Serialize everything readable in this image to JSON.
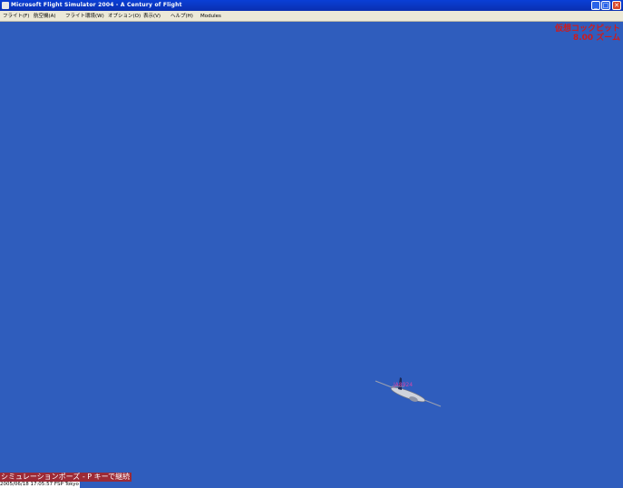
{
  "window": {
    "title": "Microsoft Flight Simulator 2004 - A Century of Flight",
    "buttons": {
      "minimize": "_",
      "maximize": "□",
      "close": "✕"
    }
  },
  "menu": {
    "items": [
      "フライト(F)",
      "航空機(A)",
      "フライト環境(W)",
      "オプション(O)",
      "表示(V)",
      "ヘルプ(H)",
      "Modules"
    ]
  },
  "hud": {
    "view_mode": "仮想コックピット",
    "zoom": "8.00 ズーム"
  },
  "aircraft": {
    "label": "JA8924"
  },
  "status": {
    "pause_message": "シミュレーションポーズ - P キーで継続",
    "timestamp": "2005/06/18 17:05:57 FSP Tokyo"
  },
  "colors": {
    "sky": "#2f5dbd",
    "hud_text": "#d11a1a",
    "pause_bg": "#9c2a36",
    "aircraft_label": "#d447a8"
  }
}
